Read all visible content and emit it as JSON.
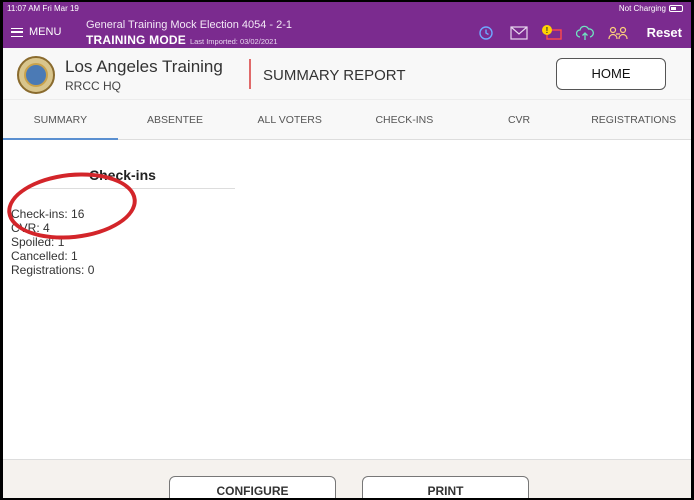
{
  "status_bar": {
    "time": "11:07 AM  Fri Mar 19",
    "charging": "Not Charging"
  },
  "topbar": {
    "menu_label": "MENU",
    "election": "General Training Mock Election 4054 - 2-1",
    "mode": "TRAINING MODE",
    "imported": "Last Imported: 03/02/2021",
    "reset_label": "Reset",
    "icons": [
      "history-icon",
      "mail-icon",
      "alert-printer-icon",
      "cloud-upload-icon",
      "users-icon"
    ],
    "accent": "#7b2b8f"
  },
  "header": {
    "org_name": "Los Angeles Training",
    "org_sub": "RRCC HQ",
    "report_title": "SUMMARY REPORT",
    "home_label": "HOME"
  },
  "tabs": [
    {
      "label": "SUMMARY",
      "active": true
    },
    {
      "label": "ABSENTEE",
      "active": false
    },
    {
      "label": "ALL VOTERS",
      "active": false
    },
    {
      "label": "CHECK-INS",
      "active": false
    },
    {
      "label": "CVR",
      "active": false
    },
    {
      "label": "REGISTRATIONS",
      "active": false
    }
  ],
  "section": {
    "title": "Check-ins",
    "stats": [
      "Check-ins: 16",
      "CVR: 4",
      "Spoiled: 1",
      "Cancelled: 1",
      "Registrations: 0"
    ]
  },
  "footer": {
    "configure_label": "CONFIGURE",
    "print_label": "PRINT"
  },
  "annotation_color": "#d3252a"
}
